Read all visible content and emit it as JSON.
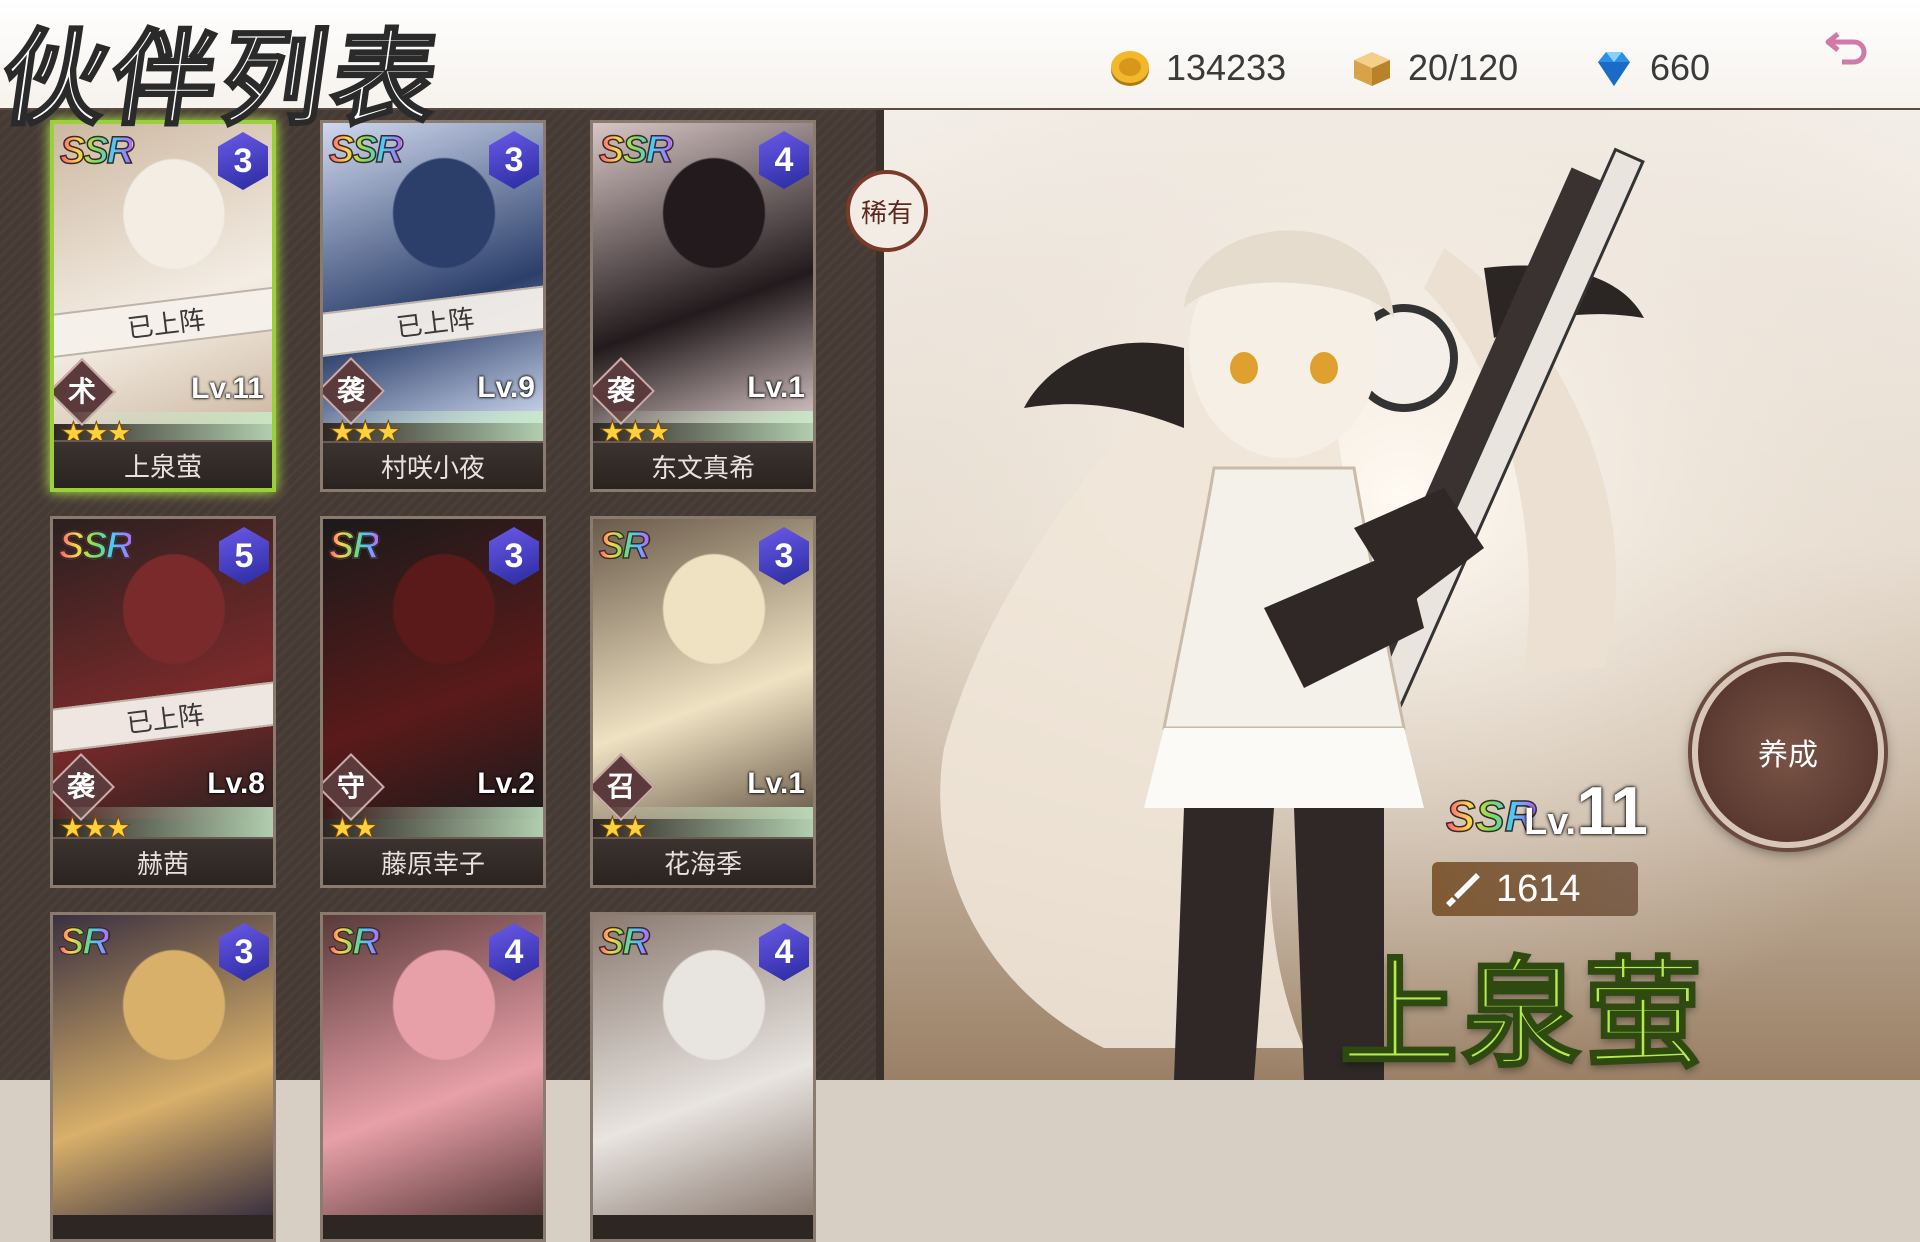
{
  "header": {
    "title": "伙伴列表"
  },
  "resources": {
    "gold": {
      "icon": "gold-coin-icon",
      "value": "134233"
    },
    "storage": {
      "icon": "crate-icon",
      "value": "20/120"
    },
    "diamond": {
      "icon": "diamond-icon",
      "value": "660"
    }
  },
  "sort_tag": "稀有",
  "cards": [
    {
      "rarity": "SSR",
      "rank": "3",
      "role": "术",
      "level": "Lv.11",
      "stars": 3,
      "name": "上泉萤",
      "deployed": "已上阵",
      "selected": true
    },
    {
      "rarity": "SSR",
      "rank": "3",
      "role": "袭",
      "level": "Lv.9",
      "stars": 3,
      "name": "村咲小夜",
      "deployed": "已上阵"
    },
    {
      "rarity": "SSR",
      "rank": "4",
      "role": "袭",
      "level": "Lv.1",
      "stars": 3,
      "name": "东文真希"
    },
    {
      "rarity": "SSR",
      "rank": "5",
      "role": "袭",
      "level": "Lv.8",
      "stars": 3,
      "name": "赫茜",
      "deployed": "已上阵"
    },
    {
      "rarity": "SR",
      "rank": "3",
      "role": "守",
      "level": "Lv.2",
      "stars": 2,
      "name": "藤原幸子"
    },
    {
      "rarity": "SR",
      "rank": "3",
      "role": "召",
      "level": "Lv.1",
      "stars": 2,
      "name": "花海季"
    },
    {
      "rarity": "SR",
      "rank": "3"
    },
    {
      "rarity": "SR",
      "rank": "4"
    },
    {
      "rarity": "SR",
      "rank": "4"
    }
  ],
  "detail": {
    "rarity": "SSR",
    "level_prefix": "Lv.",
    "level": "11",
    "power_icon": "sword-icon",
    "power": "1614",
    "name": "上泉萤",
    "train_button": "养成"
  },
  "colors": {
    "selected_border": "#9ad13a",
    "name_green": "#b6ec4a"
  }
}
